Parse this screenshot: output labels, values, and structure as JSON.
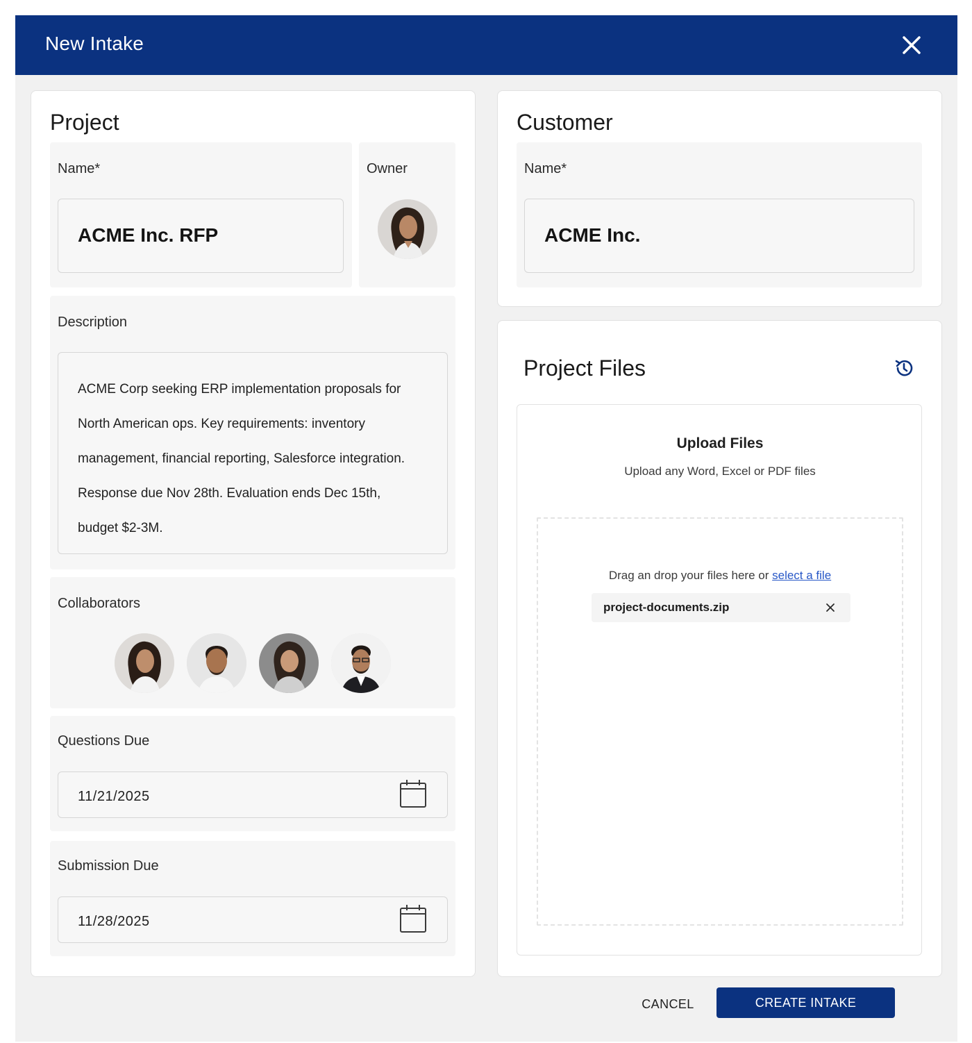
{
  "dialog": {
    "title": "New Intake",
    "close_icon": "close-icon"
  },
  "project": {
    "heading": "Project",
    "name_label": "Name*",
    "name_value": "ACME Inc. RFP",
    "owner_label": "Owner",
    "description_label": "Description",
    "description_lines": [
      "ACME Corp seeking ERP implementation proposals for",
      "North American ops. Key requirements: inventory",
      "management, financial reporting, Salesforce integration.",
      "Response due Nov 28th. Evaluation ends Dec 15th,",
      "budget $2-3M."
    ],
    "collaborators_label": "Collaborators",
    "questions_due_label": "Questions Due",
    "questions_due_value": "11/21/2025",
    "submission_due_label": "Submission Due",
    "submission_due_value": "11/28/2025"
  },
  "customer": {
    "heading": "Customer",
    "name_label": "Name*",
    "name_value": "ACME Inc."
  },
  "files": {
    "heading": "Project Files",
    "history_icon": "history-icon",
    "upload_title": "Upload Files",
    "upload_subtitle": "Upload any Word, Excel or PDF files",
    "drop_text": "Drag an drop your files here or",
    "select_link": "select a file",
    "file_name": "project-documents.zip"
  },
  "actions": {
    "cancel": "CANCEL",
    "create": "CREATE INTAKE"
  },
  "colors": {
    "brand": "#0b3280",
    "link": "#2757c7"
  }
}
